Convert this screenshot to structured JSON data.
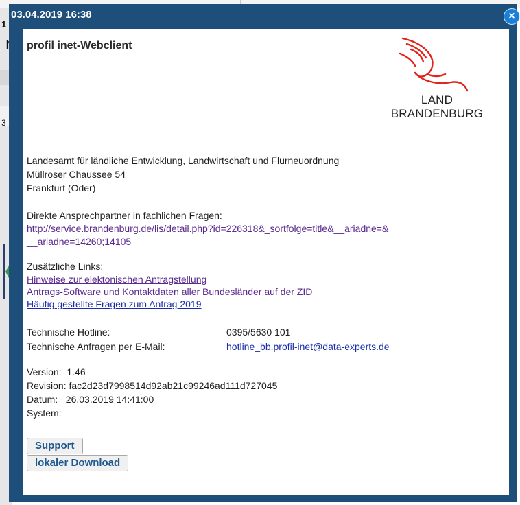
{
  "dialog": {
    "title": "03.04.2019 16:38",
    "close_glyph": "×",
    "app_name": "profil inet-Webclient"
  },
  "logo": {
    "line1": "LAND",
    "line2": "BRANDENBURG",
    "colors": {
      "eagle": "#e0231b",
      "text": "#222222"
    }
  },
  "address": {
    "line1": "Landesamt für ländliche Entwicklung, Landwirtschaft und Flurneuordnung",
    "line2": "Müllroser Chaussee 54",
    "line3": "Frankfurt (Oder)"
  },
  "contact": {
    "label": "Direkte Ansprechpartner in fachlichen Fragen:",
    "url_line1": "http://service.brandenburg.de/lis/detail.php?id=226318&_sortfolge=title&__ariadne=&",
    "url_line2": "__ariadne=14260;14105"
  },
  "links": {
    "label": "Zusätzliche Links:",
    "items": [
      "Hinweise zur elektonischen Antragstellung",
      "Antrags-Software und Kontaktdaten aller Bundesländer auf der ZID",
      "Häufig gestellte Fragen zum Antrag 2019"
    ]
  },
  "hotline": {
    "phone_label": "Technische Hotline:",
    "phone_value": "0395/5630 101",
    "email_label": "Technische Anfragen per E-Mail:",
    "email_value": "hotline_bb.profil-inet@data-experts.de"
  },
  "version": {
    "version_line": "Version:  1.46",
    "revision_line": "Revision: fac2d23d7998514d92ab21c99246ad111d727045",
    "datum_line": "Datum:   26.03.2019 14:41:00",
    "system_line": "System:"
  },
  "buttons": {
    "support": "Support",
    "download": "lokaler Download"
  },
  "background": {
    "digit_top": "1",
    "letter": "n",
    "digit_mid": "3"
  },
  "colors": {
    "dialog_frame": "#1e4f7a",
    "link_visited": "#5a2a8e",
    "link": "#1a2ea8",
    "button_text": "#1e5a90"
  }
}
